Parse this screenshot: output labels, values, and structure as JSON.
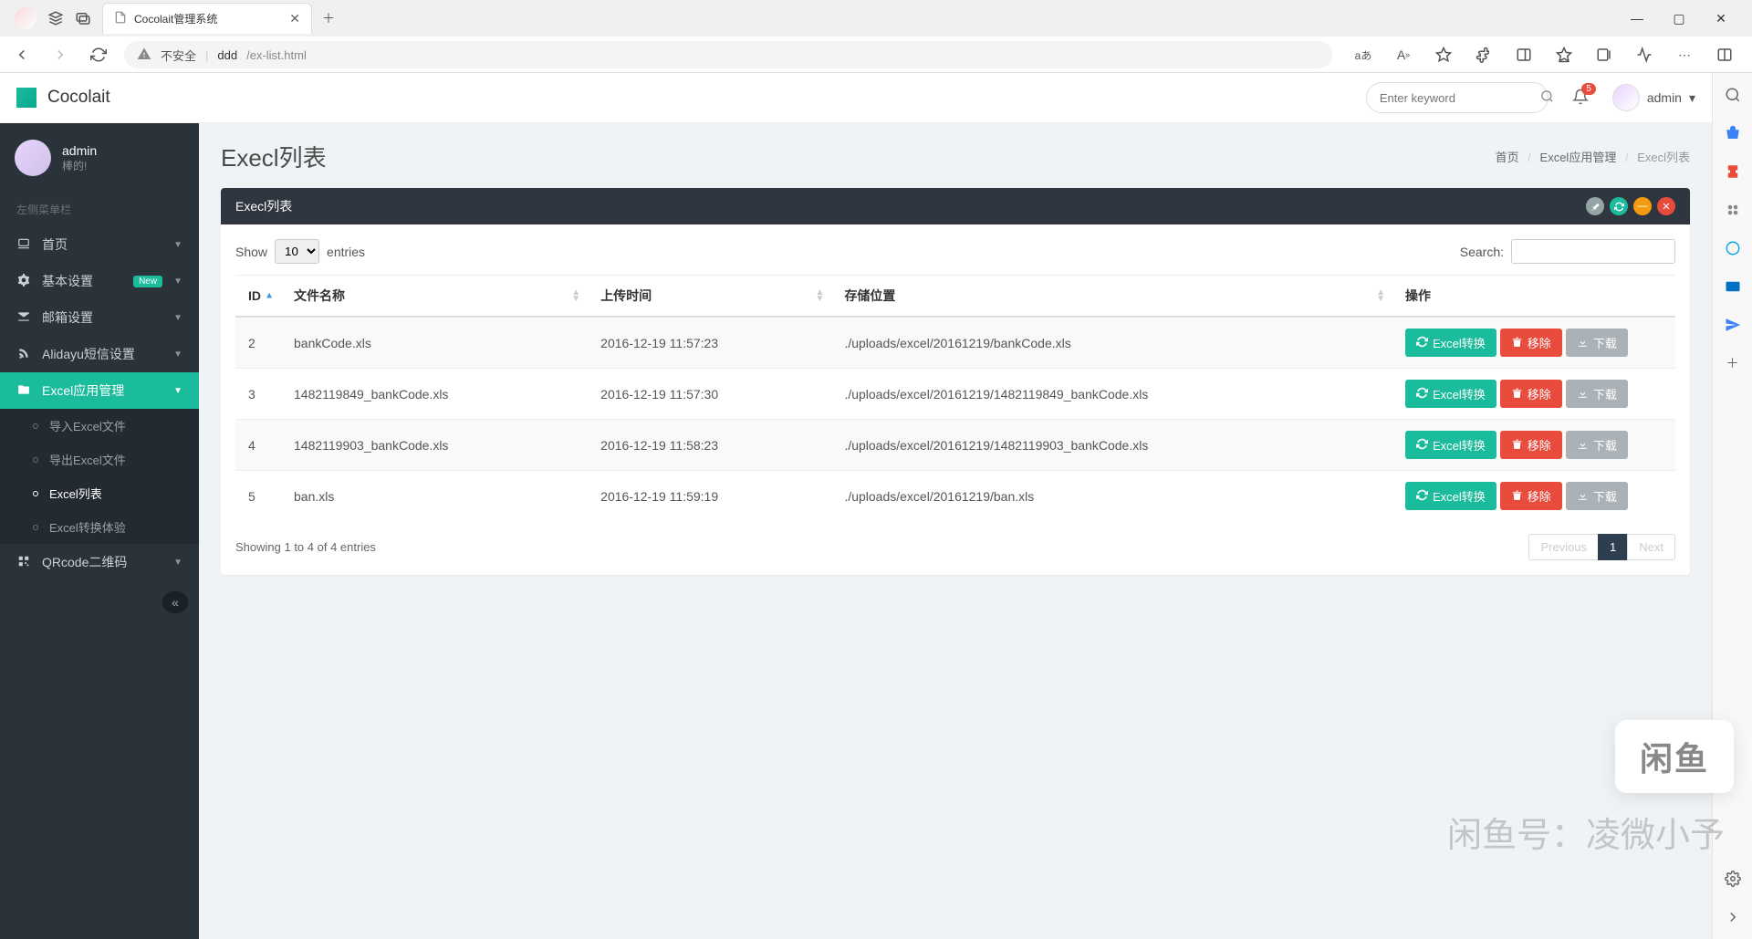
{
  "browser": {
    "tab_title": "Cocolait管理系统",
    "insecure_label": "不安全",
    "url_host": "ddd",
    "url_path": "/ex-list.html",
    "lang_badge": "aあ"
  },
  "topbar": {
    "brand": "Cocolait",
    "search_placeholder": "Enter keyword",
    "notif_count": "5",
    "user_name": "admin"
  },
  "sidebar": {
    "profile_name": "admin",
    "profile_sub": "棒的!",
    "section_label": "左侧菜单栏",
    "items": [
      {
        "icon": "laptop",
        "label": "首页"
      },
      {
        "icon": "gear",
        "label": "基本设置",
        "badge": "New"
      },
      {
        "icon": "envelope",
        "label": "邮箱设置"
      },
      {
        "icon": "rss",
        "label": "Alidayu短信设置"
      },
      {
        "icon": "folder",
        "label": "Excel应用管理",
        "active": true
      },
      {
        "icon": "qrcode",
        "label": "QRcode二维码"
      }
    ],
    "excel_sub": [
      {
        "label": "导入Excel文件"
      },
      {
        "label": "导出Excel文件"
      },
      {
        "label": "Excel列表",
        "active": true
      },
      {
        "label": "Excel转换体验"
      }
    ]
  },
  "page": {
    "title": "Execl列表",
    "crumbs": [
      "首页",
      "Excel应用管理",
      "Execl列表"
    ],
    "panel_title": "Execl列表"
  },
  "table": {
    "show_label": "Show",
    "entries_label": "entries",
    "length_value": "10",
    "search_label": "Search:",
    "columns": [
      "ID",
      "文件名称",
      "上传时间",
      "存储位置",
      "操作"
    ],
    "rows": [
      {
        "id": "2",
        "name": "bankCode.xls",
        "time": "2016-12-19 11:57:23",
        "path": "./uploads/excel/20161219/bankCode.xls"
      },
      {
        "id": "3",
        "name": "1482119849_bankCode.xls",
        "time": "2016-12-19 11:57:30",
        "path": "./uploads/excel/20161219/1482119849_bankCode.xls"
      },
      {
        "id": "4",
        "name": "1482119903_bankCode.xls",
        "time": "2016-12-19 11:58:23",
        "path": "./uploads/excel/20161219/1482119903_bankCode.xls"
      },
      {
        "id": "5",
        "name": "ban.xls",
        "time": "2016-12-19 11:59:19",
        "path": "./uploads/excel/20161219/ban.xls"
      }
    ],
    "btn_convert": "Excel转换",
    "btn_delete": "移除",
    "btn_download": "下载",
    "info": "Showing 1 to 4 of 4 entries",
    "prev": "Previous",
    "next": "Next",
    "page": "1"
  },
  "watermark": {
    "logo": "闲鱼",
    "text": "闲鱼号：凌微小予"
  }
}
